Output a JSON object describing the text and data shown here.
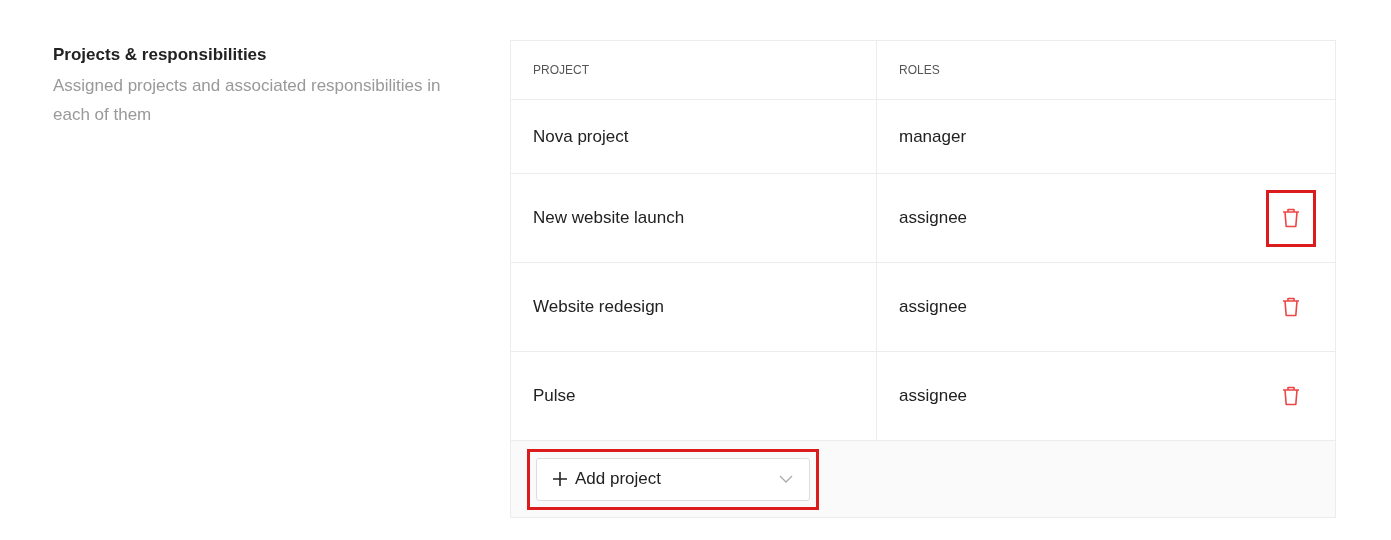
{
  "section": {
    "title": "Projects & responsibilities",
    "description": "Assigned projects and associated responsibilities in each of them"
  },
  "table": {
    "columns": [
      "PROJECT",
      "ROLES"
    ],
    "rows": [
      {
        "project": "Nova project",
        "role": "manager"
      },
      {
        "project": "New website launch",
        "role": "assignee",
        "delete_button": {
          "highlighted": true
        }
      },
      {
        "project": "Website redesign",
        "role": "assignee",
        "delete_button": {
          "highlighted": false
        }
      },
      {
        "project": "Pulse",
        "role": "assignee",
        "delete_button": {
          "highlighted": false
        }
      }
    ]
  },
  "add_button": {
    "label": "Add project",
    "highlighted": true
  }
}
